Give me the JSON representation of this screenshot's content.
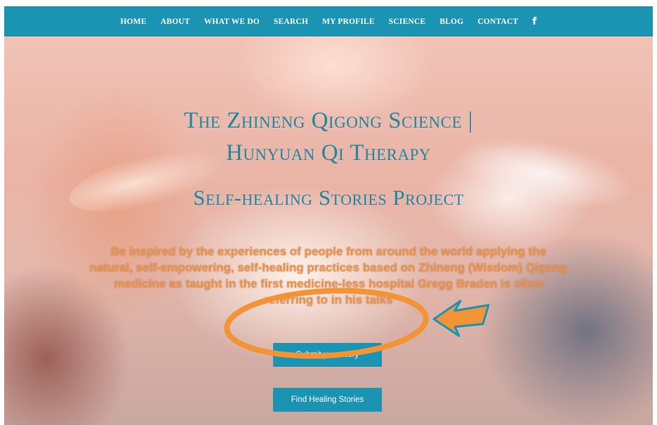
{
  "nav": {
    "items": [
      "HOME",
      "ABOUT",
      "WHAT WE DO",
      "SEARCH",
      "MY PROFILE",
      "SCIENCE",
      "BLOG",
      "CONTACT"
    ],
    "facebook_icon": "facebook-icon"
  },
  "hero": {
    "title_line1": "The Zhineng Qigong Science |",
    "title_line2": "Hunyuan Qi Therapy",
    "title_line3": "Self-healing Stories Project",
    "tagline": "Be inspired by the experiences of people from around the world applying the natural, self-empowering, self-healing practices based on Zhineng (Wisdom) Qigong medicine as taught in the first medicine-less hospital Gregg Braden is often referring to in his talks",
    "submit_button": "Submit your story",
    "find_button": "Find Healing Stories"
  },
  "colors": {
    "accent": "#1b93b3",
    "title": "#1f88a4",
    "tagline": "#e8944e",
    "annotation": "#f29435"
  }
}
